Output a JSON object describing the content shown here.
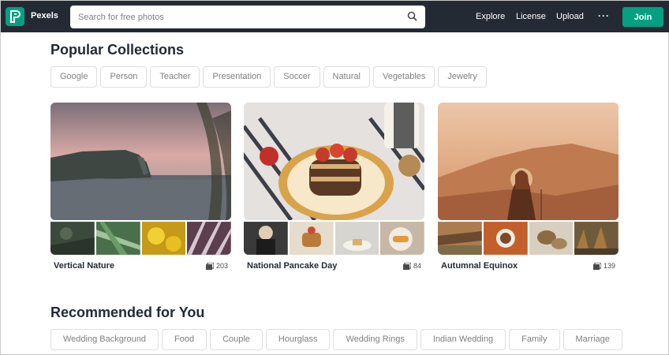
{
  "header": {
    "brand": "Pexels",
    "search_placeholder": "Search for free photos",
    "nav": [
      "Explore",
      "License",
      "Upload"
    ],
    "more": "···",
    "join": "Join"
  },
  "popular": {
    "title": "Popular Collections",
    "tags": [
      "Google",
      "Person",
      "Teacher",
      "Presentation",
      "Soccer",
      "Natural",
      "Vegetables",
      "Jewelry"
    ]
  },
  "collections": [
    {
      "name": "Vertical Nature",
      "count": "203"
    },
    {
      "name": "National Pancake Day",
      "count": "84"
    },
    {
      "name": "Autumnal Equinox",
      "count": "139"
    }
  ],
  "recommended": {
    "title": "Recommended for You",
    "tags": [
      "Wedding Background",
      "Food",
      "Couple",
      "Hourglass",
      "Wedding Rings",
      "Indian Wedding",
      "Family",
      "Marriage"
    ]
  },
  "colors": {
    "brand": "#05a081",
    "header_bg": "#232a34"
  }
}
